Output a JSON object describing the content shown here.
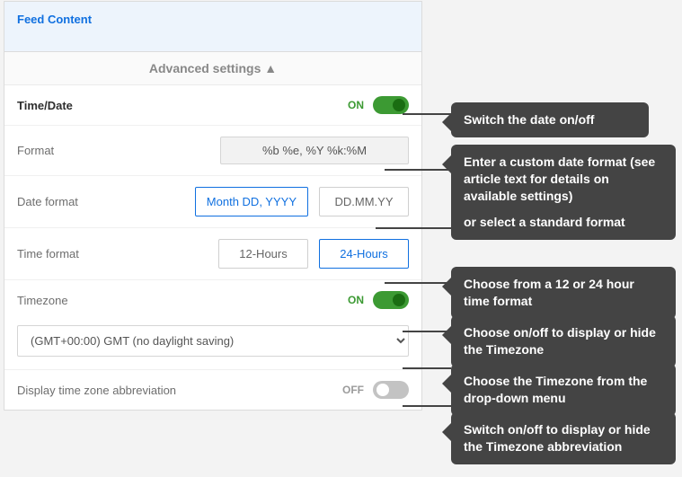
{
  "tab": {
    "title": "Feed Content"
  },
  "adv": {
    "label": "Advanced settings"
  },
  "rows": {
    "timedate": {
      "label": "Time/Date",
      "state": "ON"
    },
    "format": {
      "label": "Format",
      "value": "%b %e, %Y %k:%M"
    },
    "dateformat": {
      "label": "Date format",
      "opt1": "Month DD, YYYY",
      "opt2": "DD.MM.YY"
    },
    "timeformat": {
      "label": "Time format",
      "opt1": "12-Hours",
      "opt2": "24-Hours"
    },
    "timezone": {
      "label": "Timezone",
      "state": "ON"
    },
    "tz_select": {
      "value": "(GMT+00:00) GMT (no daylight saving)"
    },
    "abbrev": {
      "label": "Display time zone abbreviation",
      "state": "OFF"
    }
  },
  "callouts": {
    "c1": "Switch the date on/off",
    "c2a": "Enter a custom date format (see article text for details on available settings)",
    "c2b": "or select a standard format",
    "c3": "Choose from a 12 or 24 hour time format",
    "c4": "Choose on/off to display or hide the Timezone",
    "c5": "Choose the Timezone from the drop-down menu",
    "c6": "Switch on/off to display or hide the Timezone abbreviation"
  }
}
